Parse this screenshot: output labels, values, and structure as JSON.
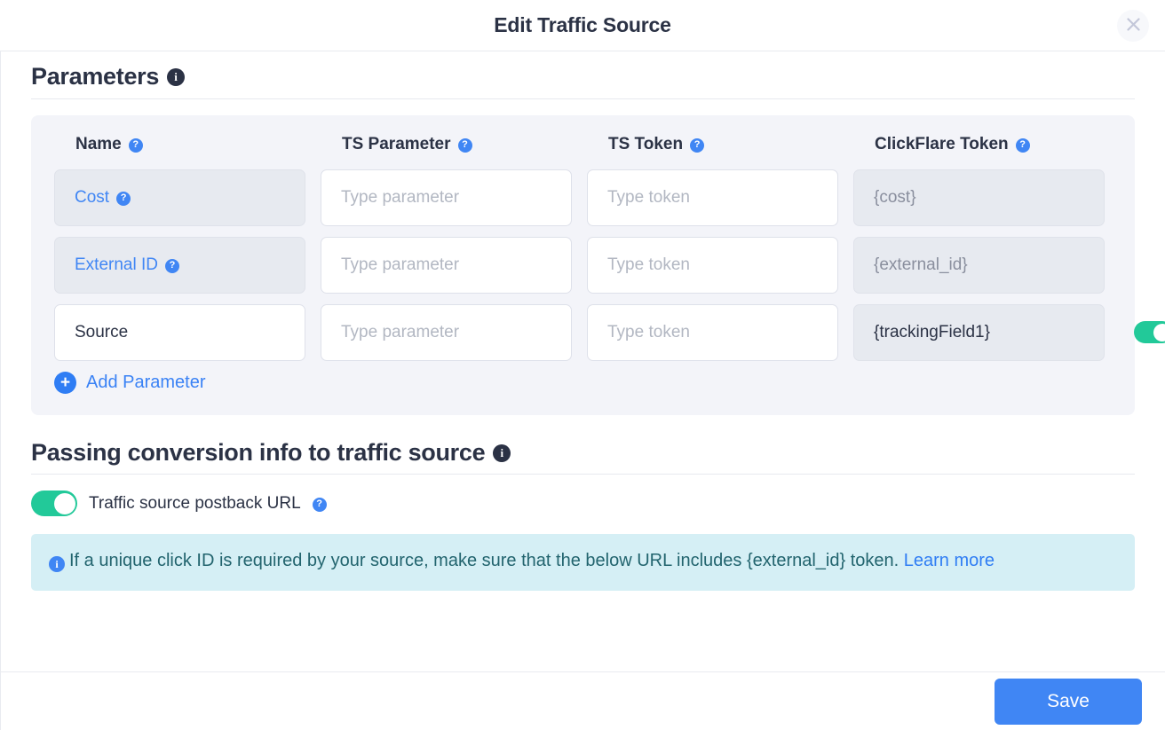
{
  "modal": {
    "title": "Edit Traffic Source",
    "close_icon": "close-icon"
  },
  "parameters_section": {
    "title": "Parameters",
    "info_icon_char": "i",
    "help_icon_char": "?",
    "columns": [
      {
        "label": "Name",
        "help": "?"
      },
      {
        "label": "TS Parameter",
        "help": "?"
      },
      {
        "label": "TS Token",
        "help": "?"
      },
      {
        "label": "ClickFlare Token",
        "help": "?"
      }
    ],
    "rows": [
      {
        "name": "Cost",
        "name_has_help": true,
        "name_locked": true,
        "ts_parameter": "",
        "ts_parameter_placeholder": "Type parameter",
        "ts_token": "",
        "ts_token_placeholder": "Type token",
        "clickflare_token": "{cost}",
        "clickflare_locked": true,
        "has_actions": false
      },
      {
        "name": "External ID",
        "name_has_help": true,
        "name_locked": true,
        "ts_parameter": "",
        "ts_parameter_placeholder": "Type parameter",
        "ts_token": "",
        "ts_token_placeholder": "Type token",
        "clickflare_token": "{external_id}",
        "clickflare_locked": true,
        "has_actions": false
      },
      {
        "name": "Source",
        "name_has_help": false,
        "name_locked": false,
        "ts_parameter": "",
        "ts_parameter_placeholder": "Type parameter",
        "ts_token": "",
        "ts_token_placeholder": "Type token",
        "clickflare_token": "{trackingField1}",
        "clickflare_locked": true,
        "has_actions": true,
        "toggle_on": true
      }
    ],
    "add_parameter_label": "Add Parameter",
    "add_parameter_icon": "+"
  },
  "conversion_section": {
    "title": "Passing conversion info to traffic source",
    "postback_toggle_on": true,
    "postback_label": "Traffic source postback URL",
    "alert": {
      "icon": "i",
      "text": "If a unique click ID is required by your source, make sure that the below URL includes {external_id} token.",
      "link_label": "Learn more"
    }
  },
  "footer": {
    "save_label": "Save"
  },
  "colors": {
    "accent_blue": "#4086f4",
    "toggle_green": "#22c999",
    "panel_bg": "#f3f4f9",
    "alert_bg": "#d5eff5",
    "alert_text": "#22646e",
    "heading": "#2b3245"
  }
}
